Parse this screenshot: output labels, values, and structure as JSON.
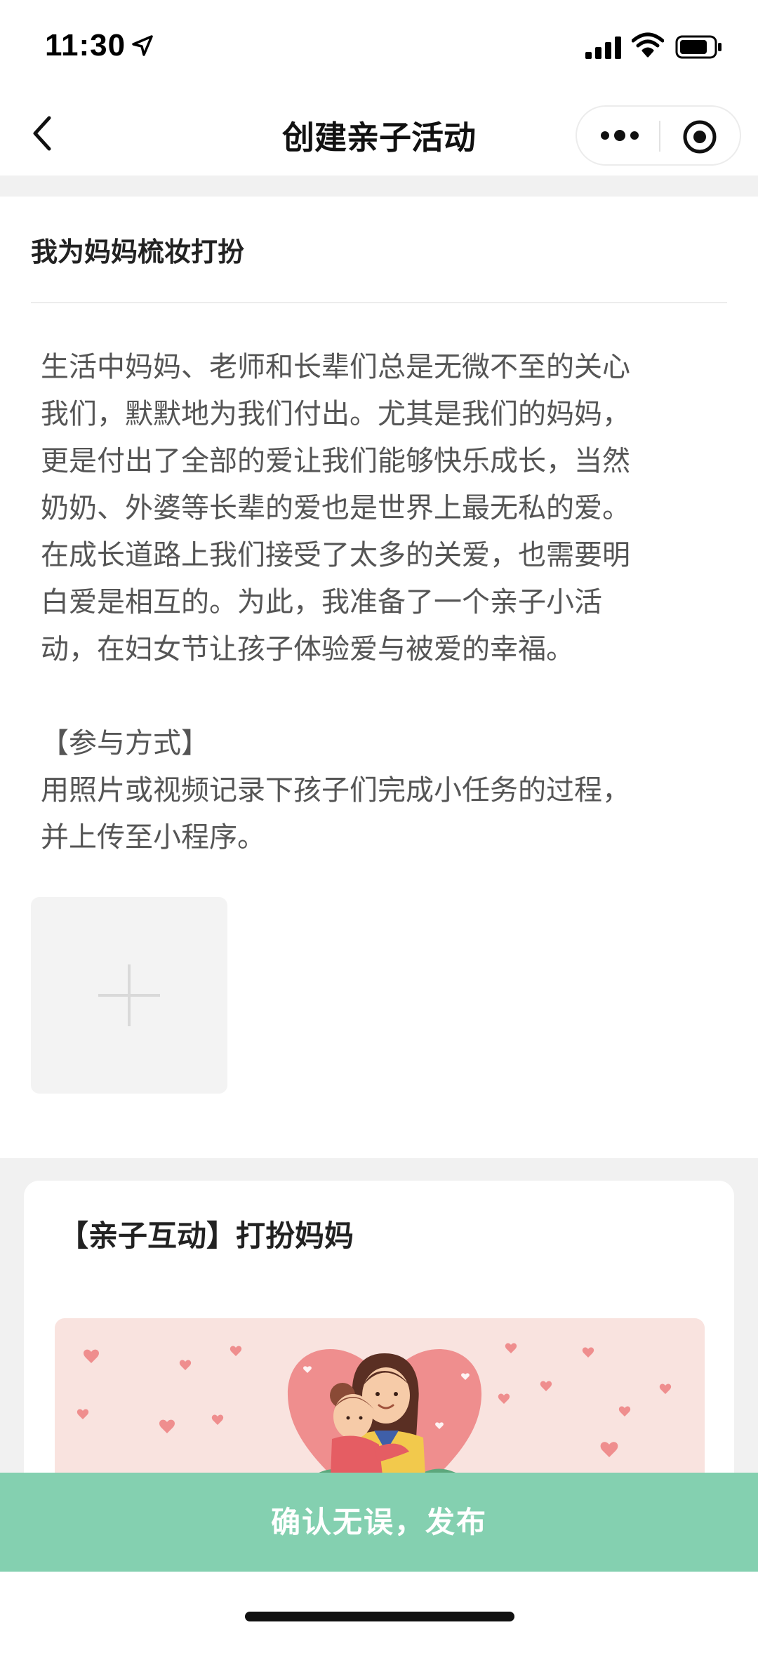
{
  "status_bar": {
    "time": "11:30",
    "icons": [
      "location-arrow-icon",
      "signal-icon",
      "wifi-icon",
      "battery-icon"
    ]
  },
  "nav": {
    "title": "创建亲子活动",
    "icons": [
      "back-icon",
      "more-icon",
      "target-icon"
    ]
  },
  "activity": {
    "title": "我为妈妈梳妆打扮",
    "description": "生活中妈妈、老师和长辈们总是无微不至的关心\n我们，默默地为我们付出。尤其是我们的妈妈，\n更是付出了全部的爱让我们能够快乐成长，当然\n奶奶、外婆等长辈的爱也是世界上最无私的爱。\n在成长道路上我们接受了太多的关爱，也需要明\n白爱是相互的。为此，我准备了一个亲子小活\n动，在妇女节让孩子体验爱与被爱的幸福。\n\n【参与方式】\n用照片或视频记录下孩子们完成小任务的过程，\n并上传至小程序。",
    "upload_icon": "plus-icon"
  },
  "interactive_card": {
    "title": "【亲子互动】打扮妈妈",
    "illustration": "mother-child-hug-illustration"
  },
  "publish_button": {
    "label": "确认无误，发布"
  },
  "colors": {
    "accent_green": "#84d0b0",
    "illustration_bg": "#f9e3df",
    "heart_pink": "#ef8e8e",
    "divider_gray": "#f1f1f1"
  }
}
